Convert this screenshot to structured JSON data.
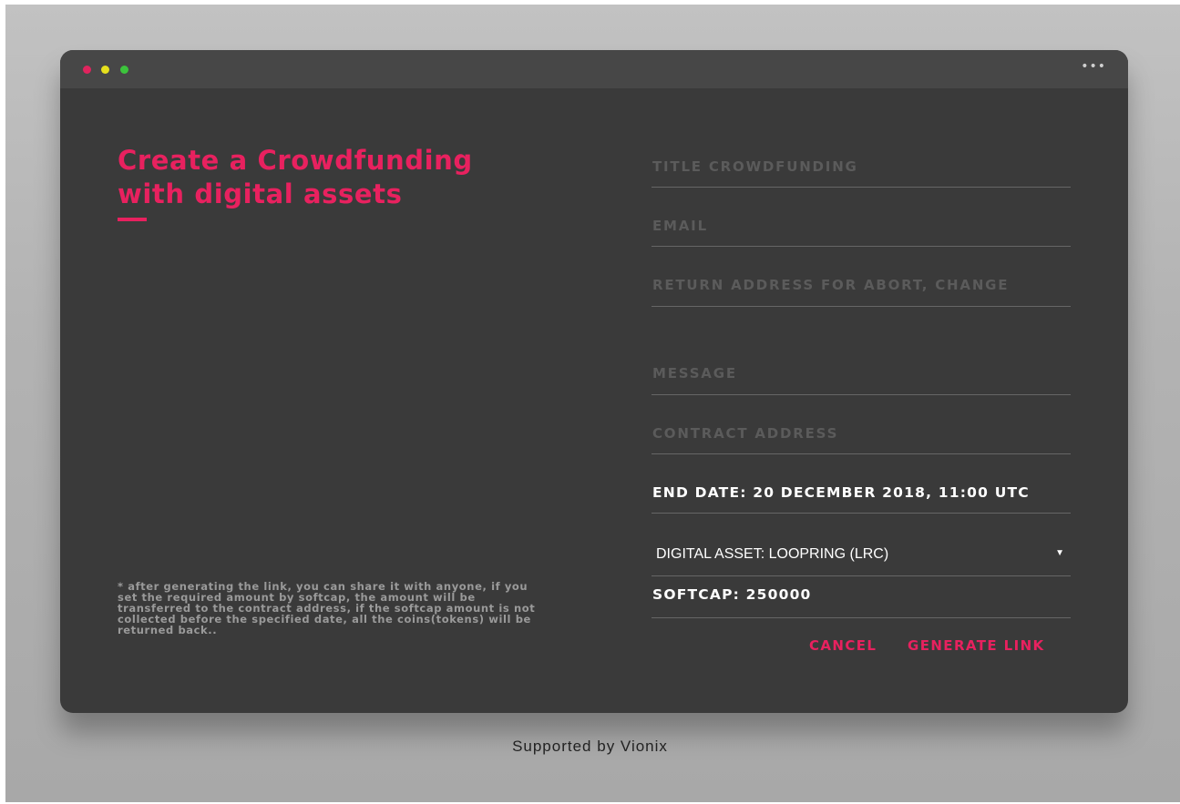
{
  "window": {
    "controls": {
      "close_color": "#e0245e",
      "minimize_color": "#e6e01d",
      "maximize_color": "#3cc43c"
    },
    "more_icon": "more-horizontal-icon",
    "more_glyph": "•••"
  },
  "left_panel": {
    "heading_line1": "Create a Crowdfunding",
    "heading_line2": "with digital assets",
    "footnote": "* after generating the link, you can share it with anyone, if you set the required amount by softcap, the amount will be transferred to the contract address, if the softcap amount is not collected before the specified date, all the coins(tokens) will be returned back.."
  },
  "form": {
    "title_placeholder": "TITLE CROWDFUNDING",
    "email_placeholder": "EMAIL",
    "return_address_placeholder": "RETURN ADDRESS FOR ABORT, CHANGE",
    "message_placeholder": "MESSAGE",
    "contract_address_placeholder": "CONTRACT ADDRESS",
    "end_date": "END DATE: 20 DECEMBER 2018, 11:00 UTC",
    "digital_asset": "DIGITAL ASSET: LOOPRING (LRC)",
    "caret": "▼",
    "softcap": "SOFTCAP: 250000"
  },
  "actions": {
    "cancel": "CANCEL",
    "generate": "GENERATE LINK"
  },
  "footer": {
    "supported_by": "Supported by Vionix"
  },
  "colors": {
    "accent": "#e8215f",
    "window_bg": "#3a3a3a",
    "titlebar_bg": "#474747",
    "page_bg": "#b8b8b8"
  }
}
